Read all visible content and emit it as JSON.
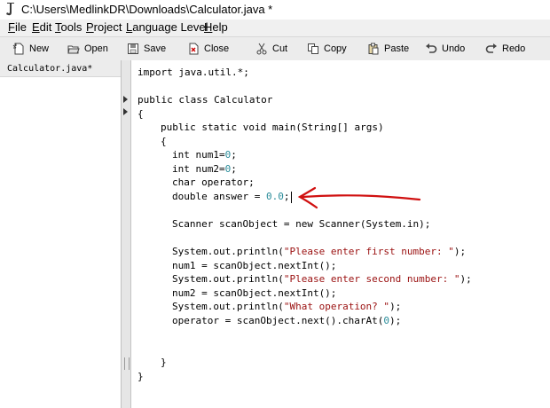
{
  "window": {
    "title": "C:\\Users\\MedlinkDR\\Downloads\\Calculator.java *"
  },
  "menu": [
    "File",
    "Edit",
    "Tools",
    "Project",
    "Language Level",
    "Help"
  ],
  "toolbar": {
    "new": "New",
    "open": "Open",
    "save": "Save",
    "close": "Close",
    "cut": "Cut",
    "copy": "Copy",
    "paste": "Paste",
    "undo": "Undo",
    "redo": "Redo"
  },
  "sidebar": {
    "open_file": "Calculator.java*"
  },
  "code": {
    "import": "import java.util.*;",
    "class_decl": "public class Calculator",
    "open_brace": "{",
    "main_decl": "public static void main(String[] args)",
    "main_open": "{",
    "l1_pre": "int num1=",
    "l1_num": "0",
    "l1_post": ";",
    "l2_pre": "int num2=",
    "l2_num": "0",
    "l2_post": ";",
    "l3": "char operator;",
    "l4_pre": "double answer = ",
    "l4_num": "0.0",
    "l4_post": ";",
    "scanner": "Scanner scanObject = new Scanner(System.in);",
    "p1_pre": "System.out.println(",
    "p1_str": "\"Please enter first number: \"",
    "p1_post": ");",
    "n1": "num1 = scanObject.nextInt();",
    "p2_pre": "System.out.println(",
    "p2_str": "\"Please enter second number: \"",
    "p2_post": ");",
    "n2": "num2 = scanObject.nextInt();",
    "p3_pre": "System.out.println(",
    "p3_str": "\"What operation? \"",
    "p3_post": ");",
    "op_pre": "operator = scanObject.next().charAt(",
    "op_num": "0",
    "op_post": ");",
    "main_close": "}",
    "class_close": "}"
  },
  "colors": {
    "number": "#2a8c9a",
    "string": "#9a1010",
    "annotation_arrow": "#d01010"
  }
}
